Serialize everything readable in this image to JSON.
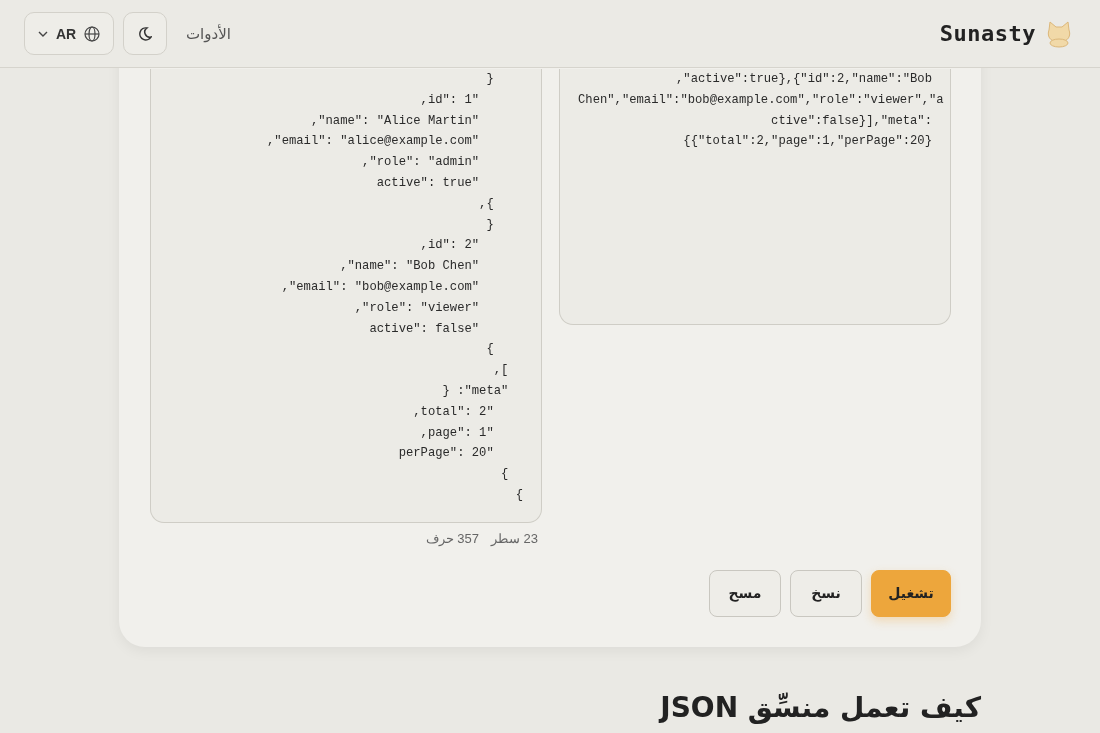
{
  "header": {
    "brand": "Sunasty",
    "nav": [
      {
        "label": "الأدوات"
      }
    ],
    "language": "AR"
  },
  "output": {
    "lines": [
      "}    ",
      ",id\": 1\"      ",
      ",\"name\": \"Alice Martin\"      ",
      ",\"email\": \"alice@example.com\"      ",
      ",\"role\": \"admin\"      ",
      "active\": true\"      ",
      ",{    ",
      "}    ",
      ",id\": 2\"      ",
      ",\"name\": \"Bob Chen\"      ",
      ",\"email\": \"bob@example.com\"      ",
      ",\"role\": \"viewer\"      ",
      "active\": false\"      ",
      "{    ",
      ",[  ",
      "} :\"meta\"  ",
      ",total\": 2\"    ",
      ",page\": 1\"    ",
      "perPage\": 20\"    ",
      "{  ",
      "{"
    ]
  },
  "input": {
    "lines": [
      ",\"active\":true},{\"id\":2,\"name\":\"Bob",
      "Chen\",\"email\":\"bob@example.com\",\"role\":\"viewer\",\"a",
      "ctive\":false}],\"meta\":",
      "{{\"total\":2,\"page\":1,\"perPage\":20}"
    ]
  },
  "stats": [
    {
      "text": "23 سطر"
    },
    {
      "text": "357 حرف"
    }
  ],
  "buttons": [
    {
      "label": "تشغيل",
      "kind": "primary"
    },
    {
      "label": "نسخ",
      "kind": "secondary"
    },
    {
      "label": "مسح",
      "kind": "secondary"
    }
  ],
  "section_heading": "كيف تعمل منسِّق JSON"
}
